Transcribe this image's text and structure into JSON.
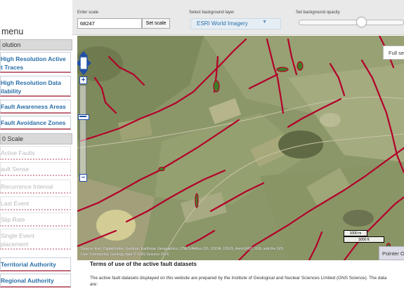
{
  "menu": {
    "title": "menu",
    "resolution_header": "olution",
    "resolution_items": [
      {
        "line1": "High Resolution Active",
        "line2": "t Traces"
      },
      {
        "line1": "High Resolution Data",
        "line2": "ilability"
      },
      {
        "line1": "Fault Awareness Areas"
      },
      {
        "line1": "Fault Avoidance Zones"
      }
    ],
    "scale_header": "0 Scale",
    "scale_items": [
      {
        "line1": "Active Faults"
      },
      {
        "line1": "ault Sense"
      },
      {
        "line1": "Recurrence Interval"
      },
      {
        "line1": "Last Event"
      },
      {
        "line1": "Slip Rate"
      },
      {
        "line1": "Single Event",
        "line2": "placement"
      }
    ],
    "authority_items": [
      {
        "line1": "Territorial Authority"
      },
      {
        "line1": "Regional Authority"
      }
    ]
  },
  "toolbar": {
    "scale_label": "Enter scale",
    "scale_value": "68247",
    "set_scale_label": "Set scale",
    "bg_layer_label": "Select background layer",
    "bg_layer_value": "ESRI World Imagery",
    "opacity_label": "Set background opacity",
    "opacity_value": 0.65
  },
  "map": {
    "fullscreen_label": "Full se",
    "attribution_line1": "Source: Esri, DigitalGlobe, GeoEye, Earthstar Geographics, CNES/Airbus DS, USDA, USGS, AeroGRID, IGN, and the GIS",
    "attribution_line2": "User Community, Geology data © GNS Science 2016",
    "scale_m": "1000 m",
    "scale_ft": "5000 ft",
    "pointer_label": "Pointer Ou",
    "fault_color": "#b3002a"
  },
  "terms": {
    "title": "Terms of use of the active fault datasets",
    "body_line1": "The active fault datasets displayed on this website are prepared by the Institute of Geological and Nuclear Sciences Limited (GNS Science). The data",
    "body_line2": "are:"
  }
}
